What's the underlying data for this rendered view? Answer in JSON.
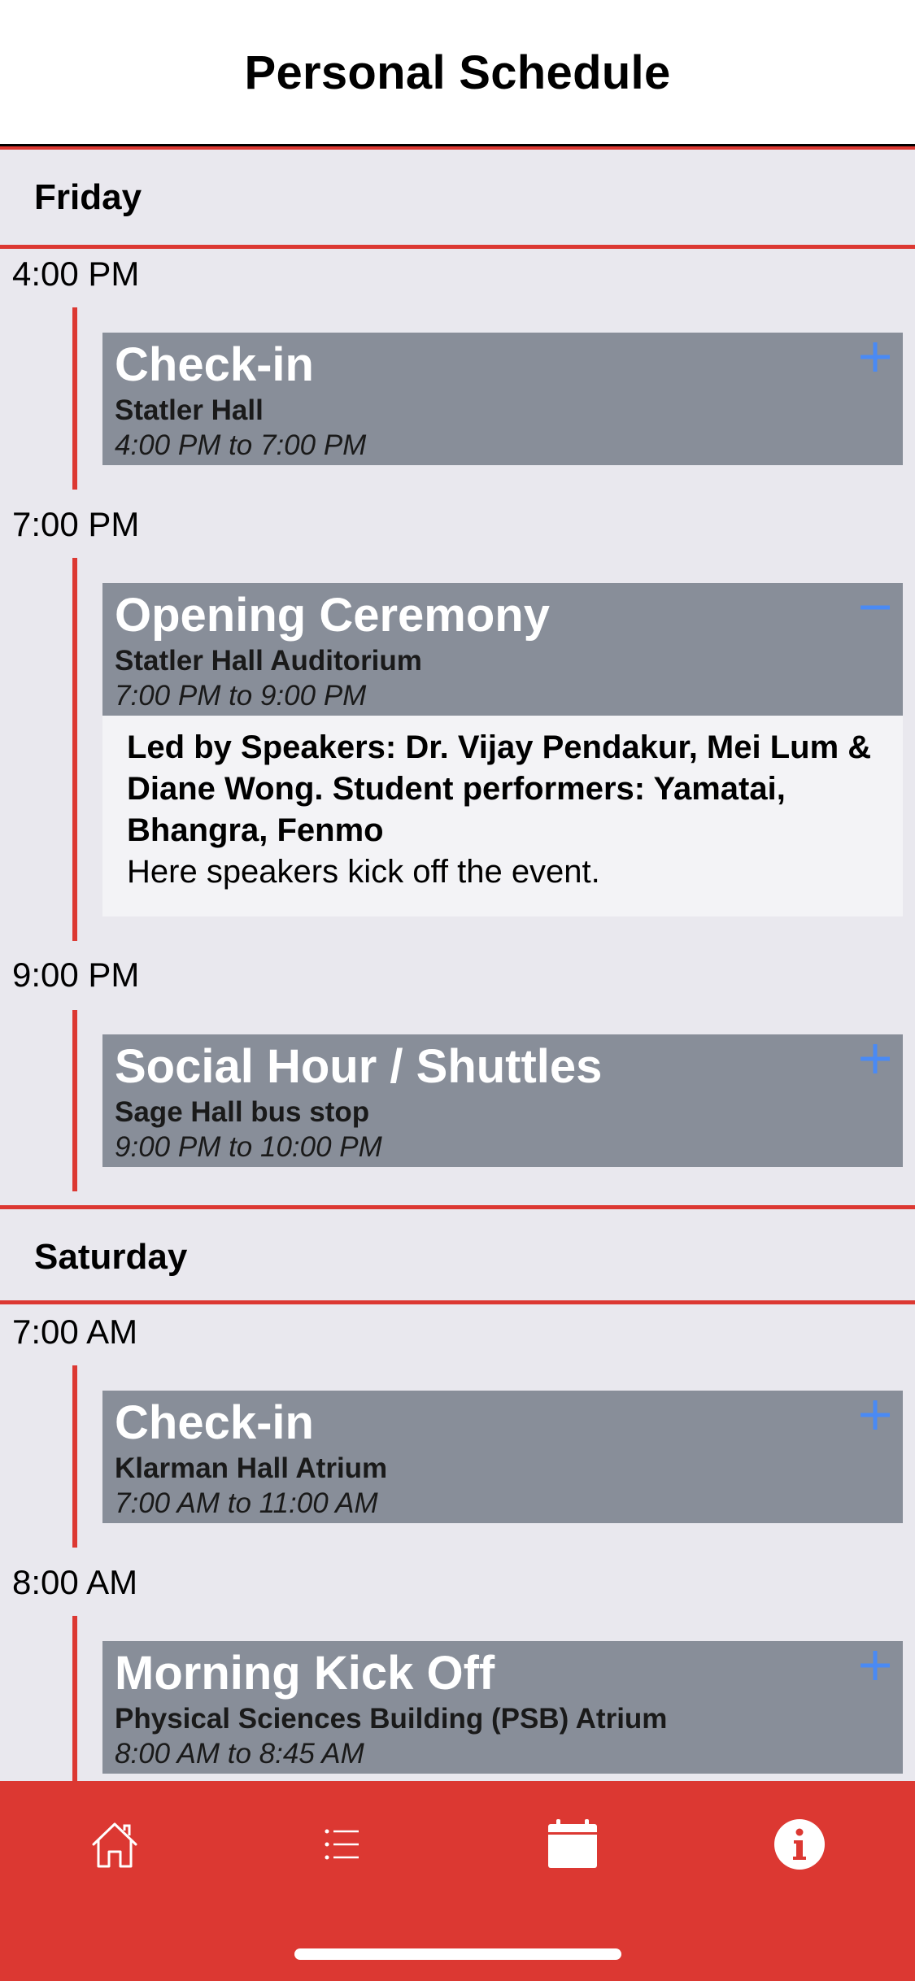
{
  "header": {
    "title": "Personal Schedule"
  },
  "days": [
    {
      "label": "Friday"
    },
    {
      "label": "Saturday"
    }
  ],
  "times": [
    "4:00 PM",
    "7:00 PM",
    "9:00 PM",
    "7:00 AM",
    "8:00 AM"
  ],
  "events": [
    {
      "title": "Check-in",
      "location": "Statler Hall",
      "time": "4:00 PM to 7:00 PM",
      "expanded": false
    },
    {
      "title": "Opening Ceremony",
      "location": "Statler Hall Auditorium",
      "time": "7:00 PM to 9:00 PM",
      "expanded": true,
      "speakers": "Led by Speakers: Dr. Vijay Pendakur, Mei Lum & Diane Wong. Student performers: Yamatai, Bhangra, Fenmo",
      "description": "Here speakers kick off the event."
    },
    {
      "title": "Social Hour / Shuttles",
      "location": "Sage Hall bus stop",
      "time": "9:00 PM to 10:00 PM",
      "expanded": false
    },
    {
      "title": "Check-in",
      "location": "Klarman Hall Atrium",
      "time": "7:00 AM to 11:00 AM",
      "expanded": false
    },
    {
      "title": "Morning Kick Off",
      "location": "Physical Sciences Building (PSB) Atrium",
      "time": "8:00 AM to 8:45 AM",
      "expanded": false
    }
  ],
  "tab_bar": {
    "items": [
      {
        "icon": "home-icon",
        "active": false
      },
      {
        "icon": "list-icon",
        "active": false
      },
      {
        "icon": "calendar-icon",
        "active": true
      },
      {
        "icon": "info-icon",
        "active": false
      }
    ]
  },
  "colors": {
    "accent_red": "#dc3832",
    "card_gray": "#888e99",
    "toggle_blue": "#4a8af4",
    "background": "#e9e8ee"
  }
}
